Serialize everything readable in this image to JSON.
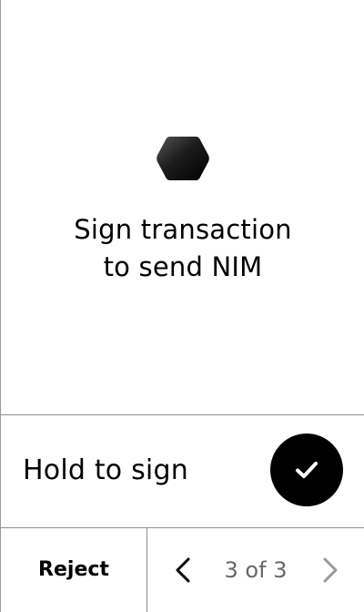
{
  "prompt": {
    "title_line1": "Sign transaction",
    "title_line2": "to send NIM",
    "logo_icon": "hexagon-logo-icon"
  },
  "hold": {
    "label": "Hold to sign",
    "button_icon": "checkmark-icon"
  },
  "footer": {
    "reject_label": "Reject",
    "prev_icon": "chevron-left-icon",
    "next_icon": "chevron-right-icon",
    "page_text": "3 of 3"
  },
  "colors": {
    "background": "#ffffff",
    "text": "#000000",
    "divider": "#8f8f8f",
    "pager_text": "#666666",
    "next_disabled": "#9a9a9a"
  }
}
